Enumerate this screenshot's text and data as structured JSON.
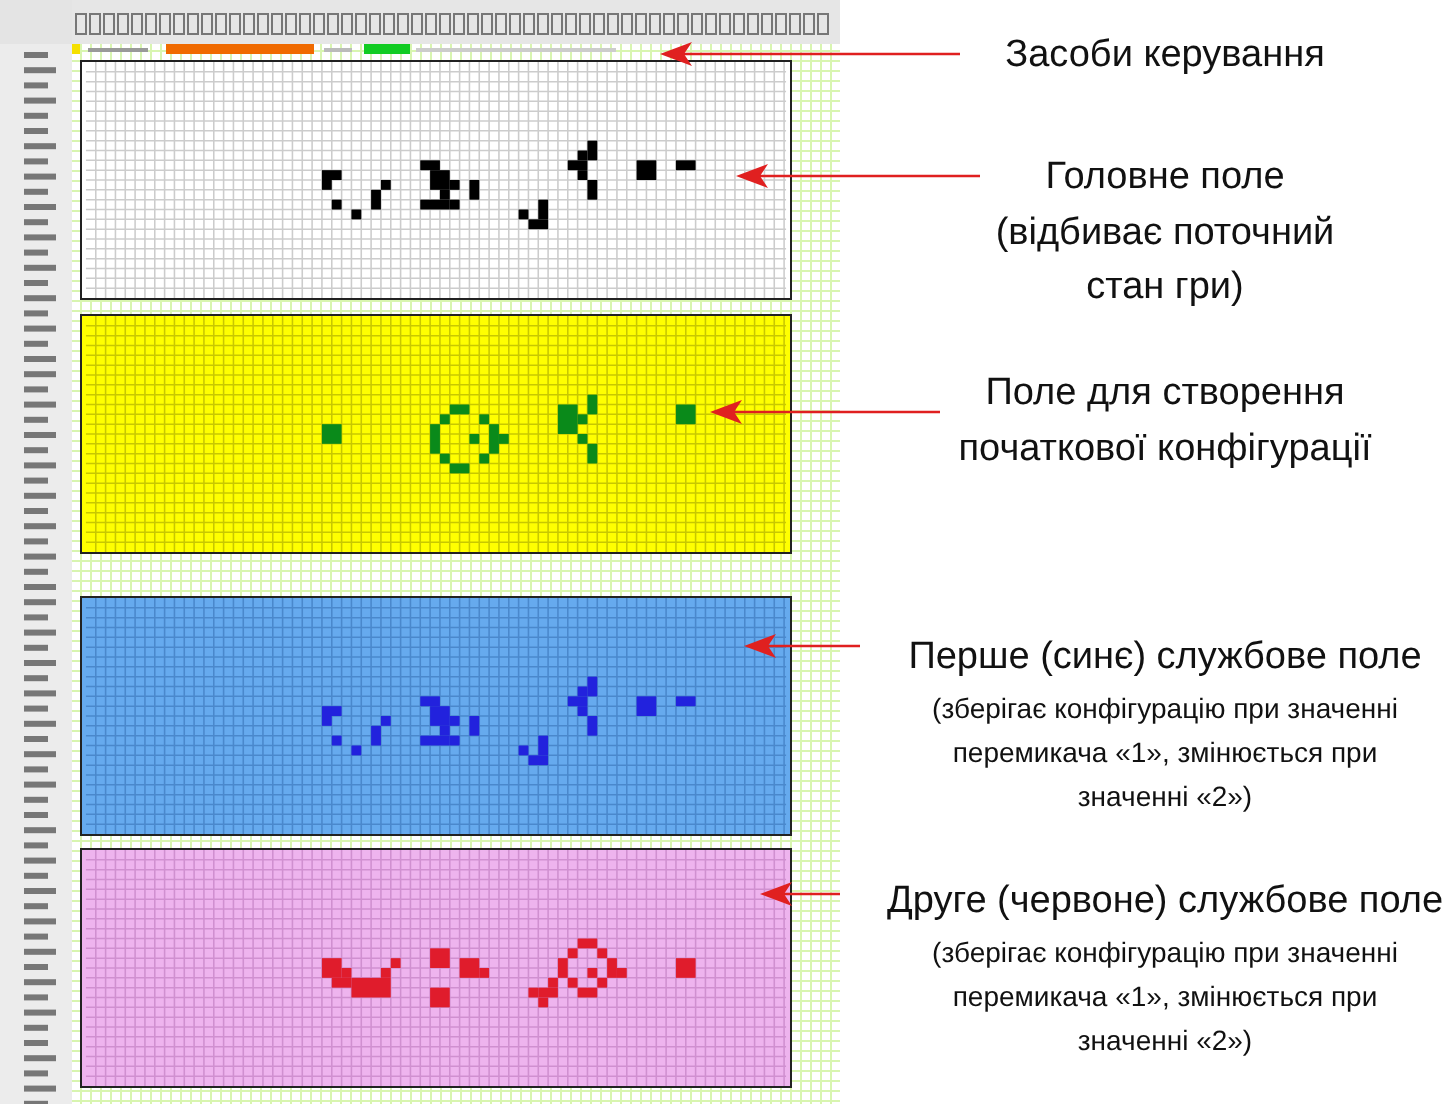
{
  "controls_label": "Засоби керування",
  "fields": [
    {
      "kind": "main",
      "color": "#ffffff",
      "title": "Головне поле",
      "note": "(відбиває поточний стан гри)"
    },
    {
      "kind": "setup",
      "color": "#ffff00",
      "title": "Поле для створення початкової конфігурації"
    },
    {
      "kind": "blue",
      "color": "#66aaee",
      "title": "Перше (синє) службове поле",
      "note": "(зберігає конфігурацію при значенні перемикача «1», змінюється при значенні «2»)"
    },
    {
      "kind": "red",
      "color": "#eeb4ee",
      "title": "Друге (червоне) службове поле",
      "note": "(зберігає конфігурацію при значенні перемикача «1», змінюється при значенні «2»)"
    }
  ]
}
